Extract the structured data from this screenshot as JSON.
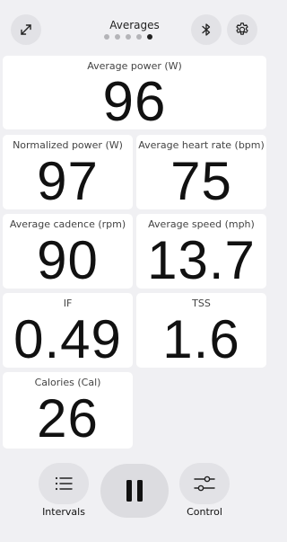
{
  "header": {
    "title": "Averages",
    "page_dots": 5,
    "active_dot": 4
  },
  "metrics": {
    "avg_power": {
      "label": "Average power (W)",
      "value": "96"
    },
    "norm_power": {
      "label": "Normalized power (W)",
      "value": "97"
    },
    "avg_hr": {
      "label": "Average heart rate (bpm)",
      "value": "75"
    },
    "avg_cadence": {
      "label": "Average cadence (rpm)",
      "value": "90"
    },
    "avg_speed": {
      "label": "Average speed (mph)",
      "value": "13.7"
    },
    "if": {
      "label": "IF",
      "value": "0.49"
    },
    "tss": {
      "label": "TSS",
      "value": "1.6"
    },
    "calories": {
      "label": "Calories (Cal)",
      "value": "26"
    }
  },
  "bottom": {
    "intervals_label": "Intervals",
    "control_label": "Control"
  },
  "icons": {
    "expand": "expand-icon",
    "bluetooth": "bluetooth-icon",
    "settings": "gear-icon",
    "intervals": "list-icon",
    "pause": "pause-icon",
    "control": "sliders-icon"
  }
}
